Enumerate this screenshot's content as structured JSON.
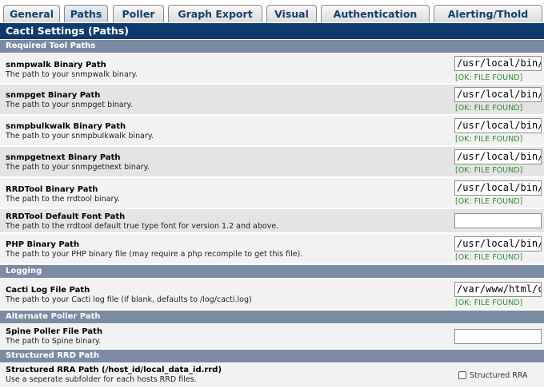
{
  "tabs": [
    {
      "label": "General",
      "active": false
    },
    {
      "label": "Paths",
      "active": true
    },
    {
      "label": "Poller",
      "active": false
    },
    {
      "label": "Graph Export",
      "active": false
    },
    {
      "label": "Visual",
      "active": false
    },
    {
      "label": "Authentication",
      "active": false
    },
    {
      "label": "Alerting/Thold",
      "active": false
    }
  ],
  "page_title": "Cacti Settings (Paths)",
  "sections": {
    "required": "Required Tool Paths",
    "logging": "Logging",
    "alternate": "Alternate Poller Path",
    "structured": "Structured RRD Path"
  },
  "settings": {
    "snmpwalk": {
      "label": "snmpwalk Binary Path",
      "desc": "The path to your snmpwalk binary.",
      "value": "/usr/local/bin/",
      "status": "[OK: FILE FOUND]"
    },
    "snmpget": {
      "label": "snmpget Binary Path",
      "desc": "The path to your snmpget binary.",
      "value": "/usr/local/bin/",
      "status": "[OK: FILE FOUND]"
    },
    "snmpbulkwalk": {
      "label": "snmpbulkwalk Binary Path",
      "desc": "The path to your snmpbulkwalk binary.",
      "value": "/usr/local/bin/",
      "status": "[OK: FILE FOUND]"
    },
    "snmpgetnext": {
      "label": "snmpgetnext Binary Path",
      "desc": "The path to your snmpgetnext binary.",
      "value": "/usr/local/bin/",
      "status": "[OK: FILE FOUND]"
    },
    "rrdtool": {
      "label": "RRDTool Binary Path",
      "desc": "The path to the rrdtool binary.",
      "value": "/usr/local/bin/",
      "status": "[OK: FILE FOUND]"
    },
    "rrdfont": {
      "label": "RRDTool Default Font Path",
      "desc": "The path to the rrdtool default true type font for version 1.2 and above.",
      "value": ""
    },
    "php": {
      "label": "PHP Binary Path",
      "desc": "The path to your PHP binary file (may require a php recompile to get this file).",
      "value": "/usr/local/bin/i",
      "status": "[OK: FILE FOUND]"
    },
    "cactilog": {
      "label": "Cacti Log File Path",
      "desc": "The path to your Cacti log file (if blank, defaults to /log/cacti.log)",
      "value": "/var/www/html/c",
      "status": "[OK: FILE FOUND]"
    },
    "spine": {
      "label": "Spine Poller File Path",
      "desc": "The path to Spine binary.",
      "value": ""
    },
    "structured": {
      "label": "Structured RRA Path (/host_id/local_data_id.rrd)",
      "desc": "Use a seperate subfolder for each hosts RRD files.",
      "checkbox_label": "Structured RRA",
      "checked": false
    }
  },
  "colors": {
    "title_bg": "#0f3a6d",
    "section_bg": "#7b8ba3",
    "ok_text": "#2f8a2f"
  }
}
